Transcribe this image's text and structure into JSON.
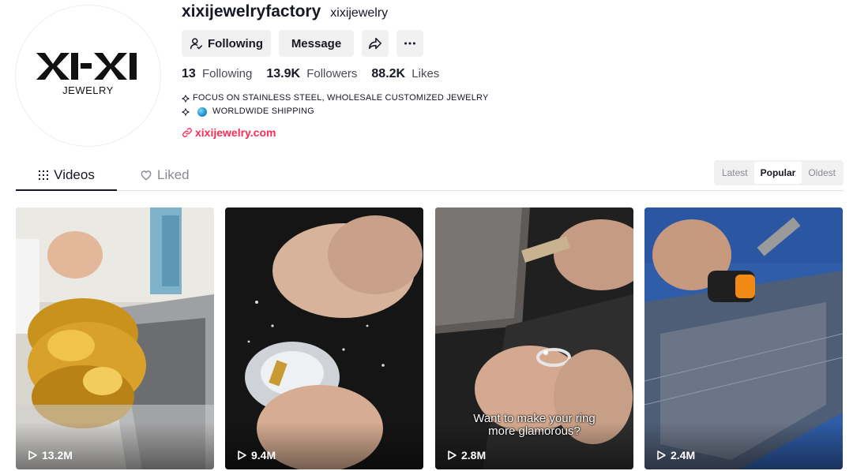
{
  "profile": {
    "avatar": {
      "logo_text": "XI-XI",
      "sub_text": "JEWELRY"
    },
    "username": "xixijewelryfactory",
    "nickname": "xixijewelry",
    "buttons": {
      "following": "Following",
      "message": "Message"
    },
    "stats": {
      "following_count": "13",
      "following_label": "Following",
      "followers_count": "13.9K",
      "followers_label": "Followers",
      "likes_count": "88.2K",
      "likes_label": "Likes"
    },
    "bio": {
      "line1": "FOCUS ON STAINLESS STEEL, WHOLESALE CUSTOMIZED JEWELRY",
      "line2": "WORLDWIDE SHIPPING"
    },
    "link": "xixijewelry.com"
  },
  "tabs": {
    "videos": "Videos",
    "liked": "Liked"
  },
  "sort": {
    "latest": "Latest",
    "popular": "Popular",
    "oldest": "Oldest",
    "active": "Popular"
  },
  "videos": [
    {
      "views": "13.2M",
      "caption": ""
    },
    {
      "views": "9.4M",
      "caption": ""
    },
    {
      "views": "2.8M",
      "caption_line1": "Want to make your ring",
      "caption_line2": "more glamorous?"
    },
    {
      "views": "2.4M",
      "caption": ""
    }
  ],
  "colors": {
    "accent": "#fe2c55",
    "text": "#161823",
    "muted": "#8a8b91",
    "button_bg": "#f1f1f2"
  }
}
